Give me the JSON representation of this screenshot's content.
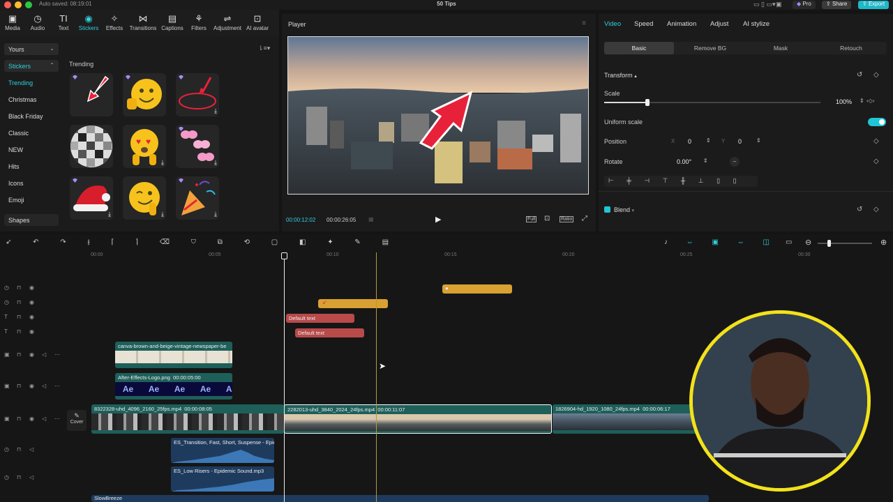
{
  "window": {
    "autosave": "Auto saved: 08:19:01",
    "title": "50 Tips",
    "pro_label": "Pro",
    "share_label": "Share",
    "export_label": "Export"
  },
  "toolbar": [
    {
      "label": "Media",
      "icon": "media-icon",
      "glyph": "▣"
    },
    {
      "label": "Audio",
      "icon": "audio-icon",
      "glyph": "◷"
    },
    {
      "label": "Text",
      "icon": "text-icon",
      "glyph": "TI"
    },
    {
      "label": "Stickers",
      "icon": "sticker-icon",
      "glyph": "◉"
    },
    {
      "label": "Effects",
      "icon": "effects-icon",
      "glyph": "✧"
    },
    {
      "label": "Transitions",
      "icon": "transitions-icon",
      "glyph": "⋈"
    },
    {
      "label": "Captions",
      "icon": "captions-icon",
      "glyph": "▤"
    },
    {
      "label": "Filters",
      "icon": "filters-icon",
      "glyph": "⚘"
    },
    {
      "label": "Adjustment",
      "icon": "adjustment-icon",
      "glyph": "⇌"
    },
    {
      "label": "AI avatar",
      "icon": "ai-avatar-icon",
      "glyph": "⊡"
    }
  ],
  "sidebar": {
    "yours": "Yours",
    "stickers": "Stickers",
    "items": [
      "Trending",
      "Christmas",
      "Black Friday",
      "Classic",
      "NEW",
      "Hits",
      "Icons",
      "Emoji"
    ],
    "shapes": "Shapes"
  },
  "stickers_panel": {
    "section_title": "Trending"
  },
  "player": {
    "title": "Player",
    "current_time": "00:00:12:02",
    "total_time": "00:00:26:05",
    "full_label": "Full",
    "ratio_label": "Ratio"
  },
  "right_panel": {
    "tabs": [
      "Video",
      "Speed",
      "Animation",
      "Adjust",
      "AI stylize"
    ],
    "subtabs": [
      "Basic",
      "Remove BG",
      "Mask",
      "Retouch"
    ],
    "transform_label": "Transform",
    "scale_label": "Scale",
    "scale_value": "100%",
    "scale_fraction": 0.2,
    "uniform_scale_label": "Uniform scale",
    "position_label": "Position",
    "pos_x_label": "X",
    "pos_x": "0",
    "pos_y_label": "Y",
    "pos_y": "0",
    "rotate_label": "Rotate",
    "rotate_value": "0.00°",
    "blend_label": "Blend"
  },
  "ruler": [
    "00:00",
    "00:05",
    "00:10",
    "00:15",
    "00:20",
    "00:25",
    "00:30"
  ],
  "timeline": {
    "cover_label": "Cover",
    "text_clip_1": "Default text",
    "text_clip_2": "Default text",
    "image_clip_1": "canva-brown-and-beige-vintage-newspaper-be",
    "image_clip_2_name": "After-Effects-Logo.png",
    "image_clip_2_dur": "00:00:05:00",
    "ae_text": "Ae",
    "main_clip_1_name": "8322328-uhd_4096_2160_25fps.mp4",
    "main_clip_1_dur": "00:00:08:05",
    "main_clip_2_name": "2282013-uhd_3840_2024_24fps.mp4",
    "main_clip_2_dur": "00:00:11:07",
    "main_clip_3_name": "1826904-hd_1920_1080_24fps.mp4",
    "main_clip_3_dur": "00:00:06:17",
    "audio_clip_1": "ES_Transition, Fast, Short, Suspense - Epid",
    "audio_clip_2": "ES_Low Risers - Epidemic Sound.mp3",
    "audio_clip_3": "SlowBreeze"
  },
  "colors": {
    "accent": "#2fd0e0",
    "sticker_track": "#d9a032",
    "text_track": "#b84a4a",
    "video_track": "#1e5f5a",
    "audio_track": "#1e3b5e"
  }
}
